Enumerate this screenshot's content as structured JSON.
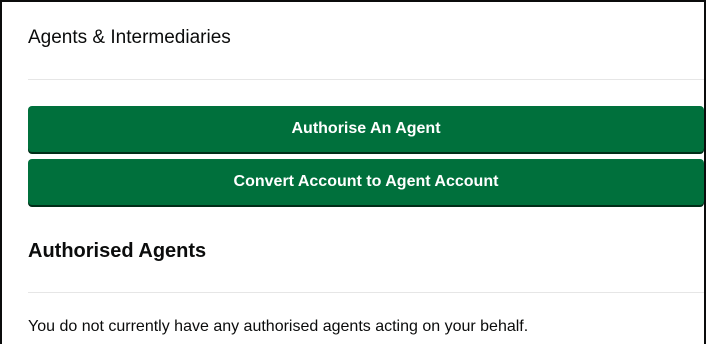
{
  "panel": {
    "title": "Agents & Intermediaries",
    "buttons": {
      "authorise_label": "Authorise An Agent",
      "convert_label": "Convert Account to Agent Account"
    },
    "authorised_section": {
      "heading": "Authorised Agents",
      "empty_message": "You do not currently have any authorised agents acting on your behalf."
    }
  },
  "colors": {
    "button_background": "#00703c",
    "button_text": "#ffffff",
    "text": "#0b0c0c",
    "divider": "#e6e6e6",
    "frame_border": "#0b0c0c"
  }
}
